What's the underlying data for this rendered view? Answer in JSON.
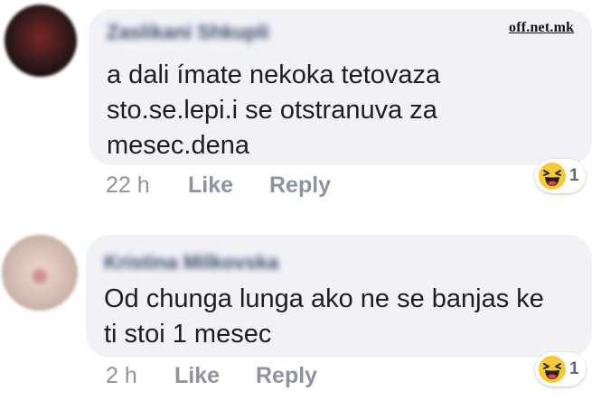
{
  "watermark": "off.net.mk",
  "colors": {
    "bubble_bg": "#f1f2f6",
    "meta_text": "#8d949e",
    "author_text": "#3b4b6a",
    "body_text": "#1c1e21"
  },
  "comments": [
    {
      "author": "Zaslikani Shkupli",
      "text_lines": [
        "a dali ímate nekoka tetovaza",
        "sto.se.lepi.i se otstranuva za",
        "mesec.dena"
      ],
      "time": "22 h",
      "like_label": "Like",
      "reply_label": "Reply",
      "reaction_icon": "haha-emoji-icon",
      "reaction_count": "1"
    },
    {
      "author": "Kristina Milkovska",
      "text_lines": [
        "Od chunga lunga ako ne se banjas ke",
        "ti stoi 1 mesec"
      ],
      "time": "2 h",
      "like_label": "Like",
      "reply_label": "Reply",
      "reaction_icon": "haha-emoji-icon",
      "reaction_count": "1"
    }
  ]
}
